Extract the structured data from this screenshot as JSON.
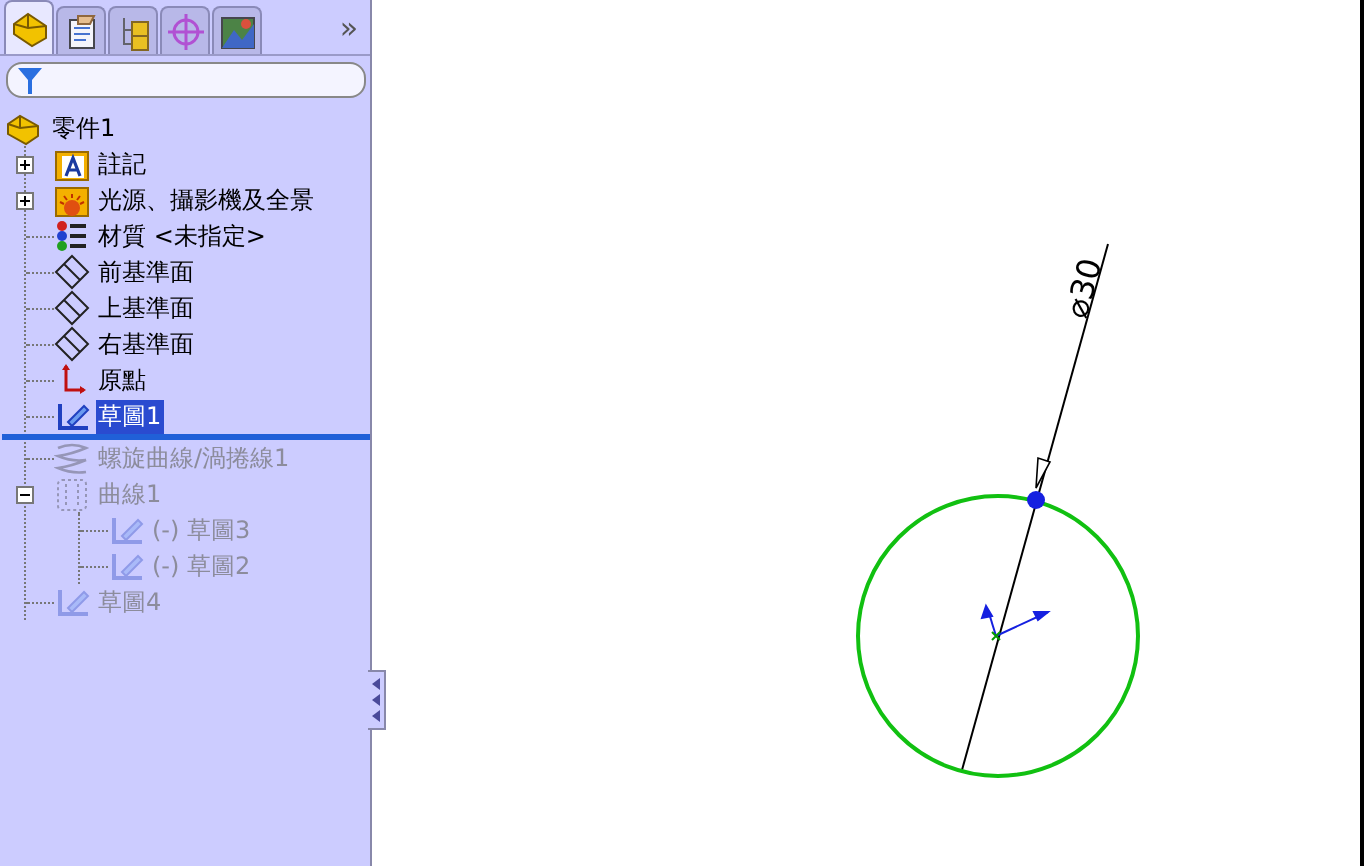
{
  "panel": {
    "tabs": [
      {
        "kind": "feature",
        "selected": true
      },
      {
        "kind": "property",
        "selected": false
      },
      {
        "kind": "config",
        "selected": false
      },
      {
        "kind": "target",
        "selected": false
      },
      {
        "kind": "display",
        "selected": false
      }
    ],
    "more": "»",
    "tree": {
      "label": "零件1",
      "kind": "part",
      "selected": false,
      "disabled": false,
      "children": [
        {
          "kind": "annotation",
          "label": "註記",
          "expanded": false,
          "selected": false,
          "disabled": false
        },
        {
          "kind": "lights",
          "label": "光源、攝影機及全景",
          "expanded": false,
          "selected": false,
          "disabled": false
        },
        {
          "kind": "material",
          "label": "材質 <未指定>",
          "selected": false,
          "disabled": false
        },
        {
          "kind": "plane",
          "label": "前基準面",
          "selected": false,
          "disabled": false
        },
        {
          "kind": "plane",
          "label": "上基準面",
          "selected": false,
          "disabled": false
        },
        {
          "kind": "plane",
          "label": "右基準面",
          "selected": false,
          "disabled": false
        },
        {
          "kind": "origin",
          "label": "原點",
          "selected": false,
          "disabled": false
        },
        {
          "kind": "sketch",
          "label": "草圖1",
          "selected": true,
          "disabled": false
        },
        {
          "kind": "rollback"
        },
        {
          "kind": "helix",
          "label": "螺旋曲線/渦捲線1",
          "selected": false,
          "disabled": true
        },
        {
          "kind": "curve",
          "label": "曲線1",
          "expanded": true,
          "selected": false,
          "disabled": true,
          "children": [
            {
              "kind": "sketch",
              "label": "(-) 草圖3",
              "selected": false,
              "disabled": true
            },
            {
              "kind": "sketch",
              "label": "(-) 草圖2",
              "selected": false,
              "disabled": true
            }
          ]
        },
        {
          "kind": "sketch",
          "label": "草圖4",
          "selected": false,
          "disabled": true
        }
      ]
    }
  },
  "canvas": {
    "dimension": "⌀30"
  }
}
